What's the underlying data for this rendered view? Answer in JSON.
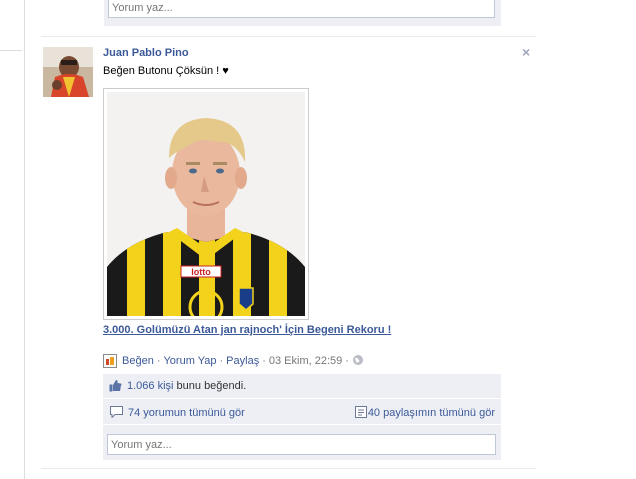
{
  "previous_post": {
    "comment_placeholder": "Yorum yaz..."
  },
  "post": {
    "author": "Juan Pablo Pino",
    "status_text": "Beğen Butonu Çöksün ! ♥",
    "link_title": "3.000. Golümüzü Atan jan rajnoch' İçin Begeni Rekoru !",
    "jersey_brand": "lotto",
    "actions": {
      "like": "Beğen",
      "comment": "Yorum Yap",
      "share": "Paylaş",
      "sep": "·",
      "timestamp": "03 Ekim, 22:59"
    },
    "likes": {
      "count_link": "1.066 kişi",
      "suffix": " bunu beğendi."
    },
    "view_comments": "74 yorumun tümünü gör",
    "view_shares": "40 paylaşımın tümünü gör",
    "comment_placeholder": "Yorum yaz..."
  },
  "icons": [
    "close-icon",
    "like-app-icon",
    "globe-icon",
    "thumbs-up-icon",
    "comment-icon",
    "share-icon"
  ]
}
